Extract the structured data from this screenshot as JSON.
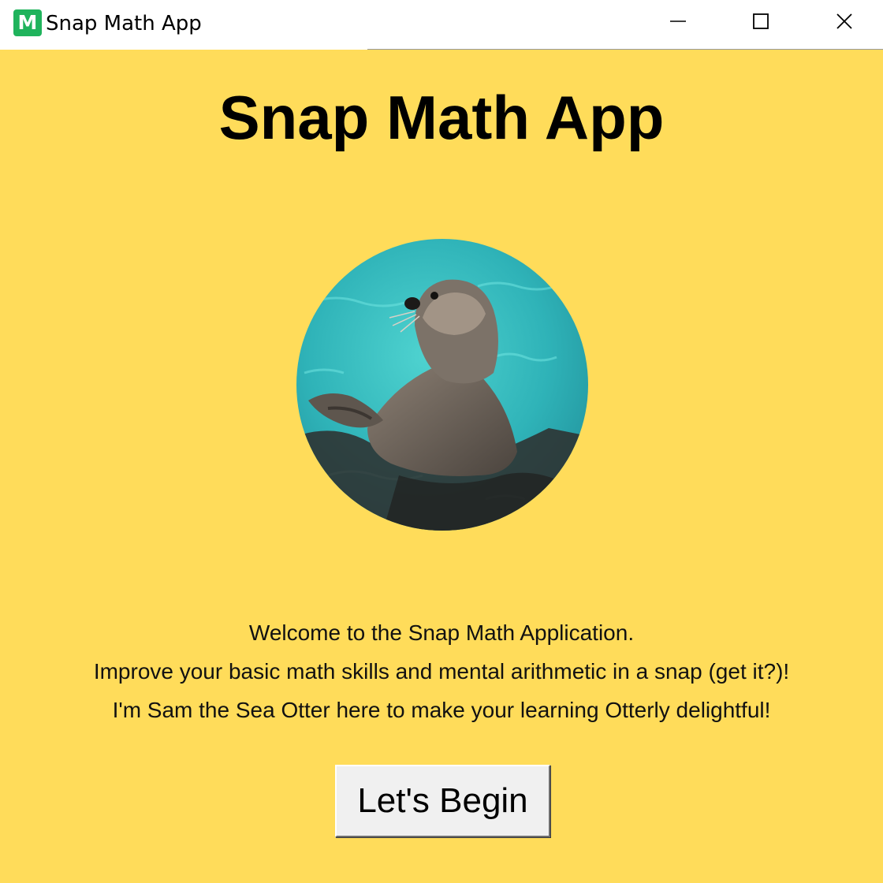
{
  "window": {
    "title": "Snap Math App",
    "icon_letter": "M",
    "icon_name": "app-logo-icon",
    "controls": [
      "minimize-icon",
      "maximize-icon",
      "close-icon"
    ]
  },
  "main": {
    "heading": "Snap Math App",
    "mascot_image": "sea-otter-photo",
    "welcome_lines": [
      "Welcome to the Snap Math Application.",
      "Improve your basic math skills and mental arithmetic in a snap (get it?)!",
      "I'm Sam the Sea Otter here to make your learning Otterly delightful!"
    ],
    "begin_button_label": "Let's Begin"
  },
  "colors": {
    "background": "#ffdc5a",
    "icon_green": "#1fb35c",
    "button_face": "#f0f0f0"
  }
}
